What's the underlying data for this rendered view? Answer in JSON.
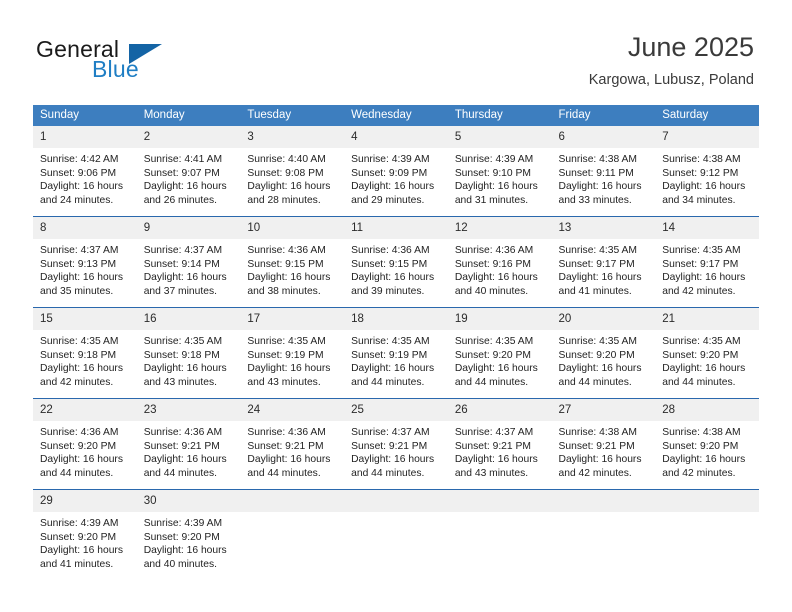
{
  "brand": {
    "word_one": "General",
    "word_two": "Blue",
    "flag_icon": "triangle-flag-icon"
  },
  "header": {
    "title": "June 2025",
    "location": "Kargowa, Lubusz, Poland"
  },
  "calendar": {
    "weekday_headers": [
      "Sunday",
      "Monday",
      "Tuesday",
      "Wednesday",
      "Thursday",
      "Friday",
      "Saturday"
    ],
    "colors": {
      "header_blue": "#3d7ebf",
      "rule_blue": "#2a68ad",
      "daynum_band": "#f0f0f0",
      "brand_blue": "#1f7ec4",
      "flag_blue": "#1464a5"
    },
    "labels": {
      "sunrise_prefix": "Sunrise:",
      "sunset_prefix": "Sunset:",
      "daylight_prefix": "Daylight:"
    },
    "weeks": [
      [
        {
          "day": "1",
          "sunrise": "Sunrise: 4:42 AM",
          "sunset": "Sunset: 9:06 PM",
          "daylight_line1": "Daylight: 16 hours",
          "daylight_line2": "and 24 minutes."
        },
        {
          "day": "2",
          "sunrise": "Sunrise: 4:41 AM",
          "sunset": "Sunset: 9:07 PM",
          "daylight_line1": "Daylight: 16 hours",
          "daylight_line2": "and 26 minutes."
        },
        {
          "day": "3",
          "sunrise": "Sunrise: 4:40 AM",
          "sunset": "Sunset: 9:08 PM",
          "daylight_line1": "Daylight: 16 hours",
          "daylight_line2": "and 28 minutes."
        },
        {
          "day": "4",
          "sunrise": "Sunrise: 4:39 AM",
          "sunset": "Sunset: 9:09 PM",
          "daylight_line1": "Daylight: 16 hours",
          "daylight_line2": "and 29 minutes."
        },
        {
          "day": "5",
          "sunrise": "Sunrise: 4:39 AM",
          "sunset": "Sunset: 9:10 PM",
          "daylight_line1": "Daylight: 16 hours",
          "daylight_line2": "and 31 minutes."
        },
        {
          "day": "6",
          "sunrise": "Sunrise: 4:38 AM",
          "sunset": "Sunset: 9:11 PM",
          "daylight_line1": "Daylight: 16 hours",
          "daylight_line2": "and 33 minutes."
        },
        {
          "day": "7",
          "sunrise": "Sunrise: 4:38 AM",
          "sunset": "Sunset: 9:12 PM",
          "daylight_line1": "Daylight: 16 hours",
          "daylight_line2": "and 34 minutes."
        }
      ],
      [
        {
          "day": "8",
          "sunrise": "Sunrise: 4:37 AM",
          "sunset": "Sunset: 9:13 PM",
          "daylight_line1": "Daylight: 16 hours",
          "daylight_line2": "and 35 minutes."
        },
        {
          "day": "9",
          "sunrise": "Sunrise: 4:37 AM",
          "sunset": "Sunset: 9:14 PM",
          "daylight_line1": "Daylight: 16 hours",
          "daylight_line2": "and 37 minutes."
        },
        {
          "day": "10",
          "sunrise": "Sunrise: 4:36 AM",
          "sunset": "Sunset: 9:15 PM",
          "daylight_line1": "Daylight: 16 hours",
          "daylight_line2": "and 38 minutes."
        },
        {
          "day": "11",
          "sunrise": "Sunrise: 4:36 AM",
          "sunset": "Sunset: 9:15 PM",
          "daylight_line1": "Daylight: 16 hours",
          "daylight_line2": "and 39 minutes."
        },
        {
          "day": "12",
          "sunrise": "Sunrise: 4:36 AM",
          "sunset": "Sunset: 9:16 PM",
          "daylight_line1": "Daylight: 16 hours",
          "daylight_line2": "and 40 minutes."
        },
        {
          "day": "13",
          "sunrise": "Sunrise: 4:35 AM",
          "sunset": "Sunset: 9:17 PM",
          "daylight_line1": "Daylight: 16 hours",
          "daylight_line2": "and 41 minutes."
        },
        {
          "day": "14",
          "sunrise": "Sunrise: 4:35 AM",
          "sunset": "Sunset: 9:17 PM",
          "daylight_line1": "Daylight: 16 hours",
          "daylight_line2": "and 42 minutes."
        }
      ],
      [
        {
          "day": "15",
          "sunrise": "Sunrise: 4:35 AM",
          "sunset": "Sunset: 9:18 PM",
          "daylight_line1": "Daylight: 16 hours",
          "daylight_line2": "and 42 minutes."
        },
        {
          "day": "16",
          "sunrise": "Sunrise: 4:35 AM",
          "sunset": "Sunset: 9:18 PM",
          "daylight_line1": "Daylight: 16 hours",
          "daylight_line2": "and 43 minutes."
        },
        {
          "day": "17",
          "sunrise": "Sunrise: 4:35 AM",
          "sunset": "Sunset: 9:19 PM",
          "daylight_line1": "Daylight: 16 hours",
          "daylight_line2": "and 43 minutes."
        },
        {
          "day": "18",
          "sunrise": "Sunrise: 4:35 AM",
          "sunset": "Sunset: 9:19 PM",
          "daylight_line1": "Daylight: 16 hours",
          "daylight_line2": "and 44 minutes."
        },
        {
          "day": "19",
          "sunrise": "Sunrise: 4:35 AM",
          "sunset": "Sunset: 9:20 PM",
          "daylight_line1": "Daylight: 16 hours",
          "daylight_line2": "and 44 minutes."
        },
        {
          "day": "20",
          "sunrise": "Sunrise: 4:35 AM",
          "sunset": "Sunset: 9:20 PM",
          "daylight_line1": "Daylight: 16 hours",
          "daylight_line2": "and 44 minutes."
        },
        {
          "day": "21",
          "sunrise": "Sunrise: 4:35 AM",
          "sunset": "Sunset: 9:20 PM",
          "daylight_line1": "Daylight: 16 hours",
          "daylight_line2": "and 44 minutes."
        }
      ],
      [
        {
          "day": "22",
          "sunrise": "Sunrise: 4:36 AM",
          "sunset": "Sunset: 9:20 PM",
          "daylight_line1": "Daylight: 16 hours",
          "daylight_line2": "and 44 minutes."
        },
        {
          "day": "23",
          "sunrise": "Sunrise: 4:36 AM",
          "sunset": "Sunset: 9:21 PM",
          "daylight_line1": "Daylight: 16 hours",
          "daylight_line2": "and 44 minutes."
        },
        {
          "day": "24",
          "sunrise": "Sunrise: 4:36 AM",
          "sunset": "Sunset: 9:21 PM",
          "daylight_line1": "Daylight: 16 hours",
          "daylight_line2": "and 44 minutes."
        },
        {
          "day": "25",
          "sunrise": "Sunrise: 4:37 AM",
          "sunset": "Sunset: 9:21 PM",
          "daylight_line1": "Daylight: 16 hours",
          "daylight_line2": "and 44 minutes."
        },
        {
          "day": "26",
          "sunrise": "Sunrise: 4:37 AM",
          "sunset": "Sunset: 9:21 PM",
          "daylight_line1": "Daylight: 16 hours",
          "daylight_line2": "and 43 minutes."
        },
        {
          "day": "27",
          "sunrise": "Sunrise: 4:38 AM",
          "sunset": "Sunset: 9:21 PM",
          "daylight_line1": "Daylight: 16 hours",
          "daylight_line2": "and 42 minutes."
        },
        {
          "day": "28",
          "sunrise": "Sunrise: 4:38 AM",
          "sunset": "Sunset: 9:20 PM",
          "daylight_line1": "Daylight: 16 hours",
          "daylight_line2": "and 42 minutes."
        }
      ],
      [
        {
          "day": "29",
          "sunrise": "Sunrise: 4:39 AM",
          "sunset": "Sunset: 9:20 PM",
          "daylight_line1": "Daylight: 16 hours",
          "daylight_line2": "and 41 minutes."
        },
        {
          "day": "30",
          "sunrise": "Sunrise: 4:39 AM",
          "sunset": "Sunset: 9:20 PM",
          "daylight_line1": "Daylight: 16 hours",
          "daylight_line2": "and 40 minutes."
        },
        {
          "day": "",
          "sunrise": "",
          "sunset": "",
          "daylight_line1": "",
          "daylight_line2": ""
        },
        {
          "day": "",
          "sunrise": "",
          "sunset": "",
          "daylight_line1": "",
          "daylight_line2": ""
        },
        {
          "day": "",
          "sunrise": "",
          "sunset": "",
          "daylight_line1": "",
          "daylight_line2": ""
        },
        {
          "day": "",
          "sunrise": "",
          "sunset": "",
          "daylight_line1": "",
          "daylight_line2": ""
        },
        {
          "day": "",
          "sunrise": "",
          "sunset": "",
          "daylight_line1": "",
          "daylight_line2": ""
        }
      ]
    ]
  }
}
